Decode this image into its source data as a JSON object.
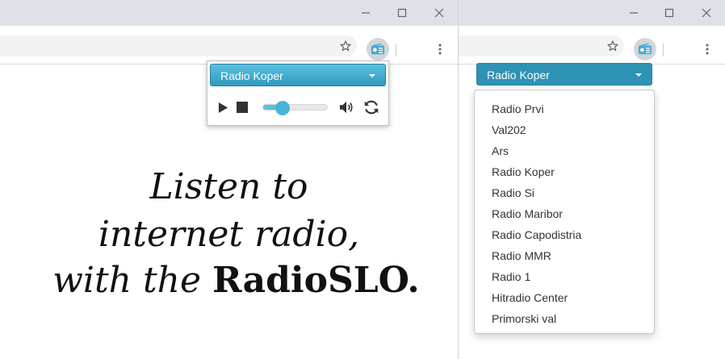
{
  "left_window": {
    "popup": {
      "selected_station": "Radio Koper",
      "volume": 0.3
    },
    "slogan": {
      "line1": "Listen to",
      "line2": "internet radio,",
      "line3_prefix": "with the ",
      "line3_brand": "RadioSLO."
    }
  },
  "right_window": {
    "popup": {
      "selected_station": "Radio Koper",
      "stations": [
        "Radio Prvi",
        "Val202",
        "Ars",
        "Radio Koper",
        "Radio Si",
        "Radio Maribor",
        "Radio Capodistria",
        "Radio MMR",
        "Radio 1",
        "Hitradio Center",
        "Primorski val"
      ]
    }
  },
  "colors": {
    "accent": "#2e92b4",
    "titlebar": "#dee1e6",
    "slider": "#5bc0de"
  },
  "icons": [
    "minimize-icon",
    "maximize-icon",
    "close-icon",
    "star-icon",
    "radio-icon",
    "more-vert-icon",
    "play-icon",
    "stop-icon",
    "volume-icon",
    "refresh-icon",
    "caret-down-icon"
  ]
}
